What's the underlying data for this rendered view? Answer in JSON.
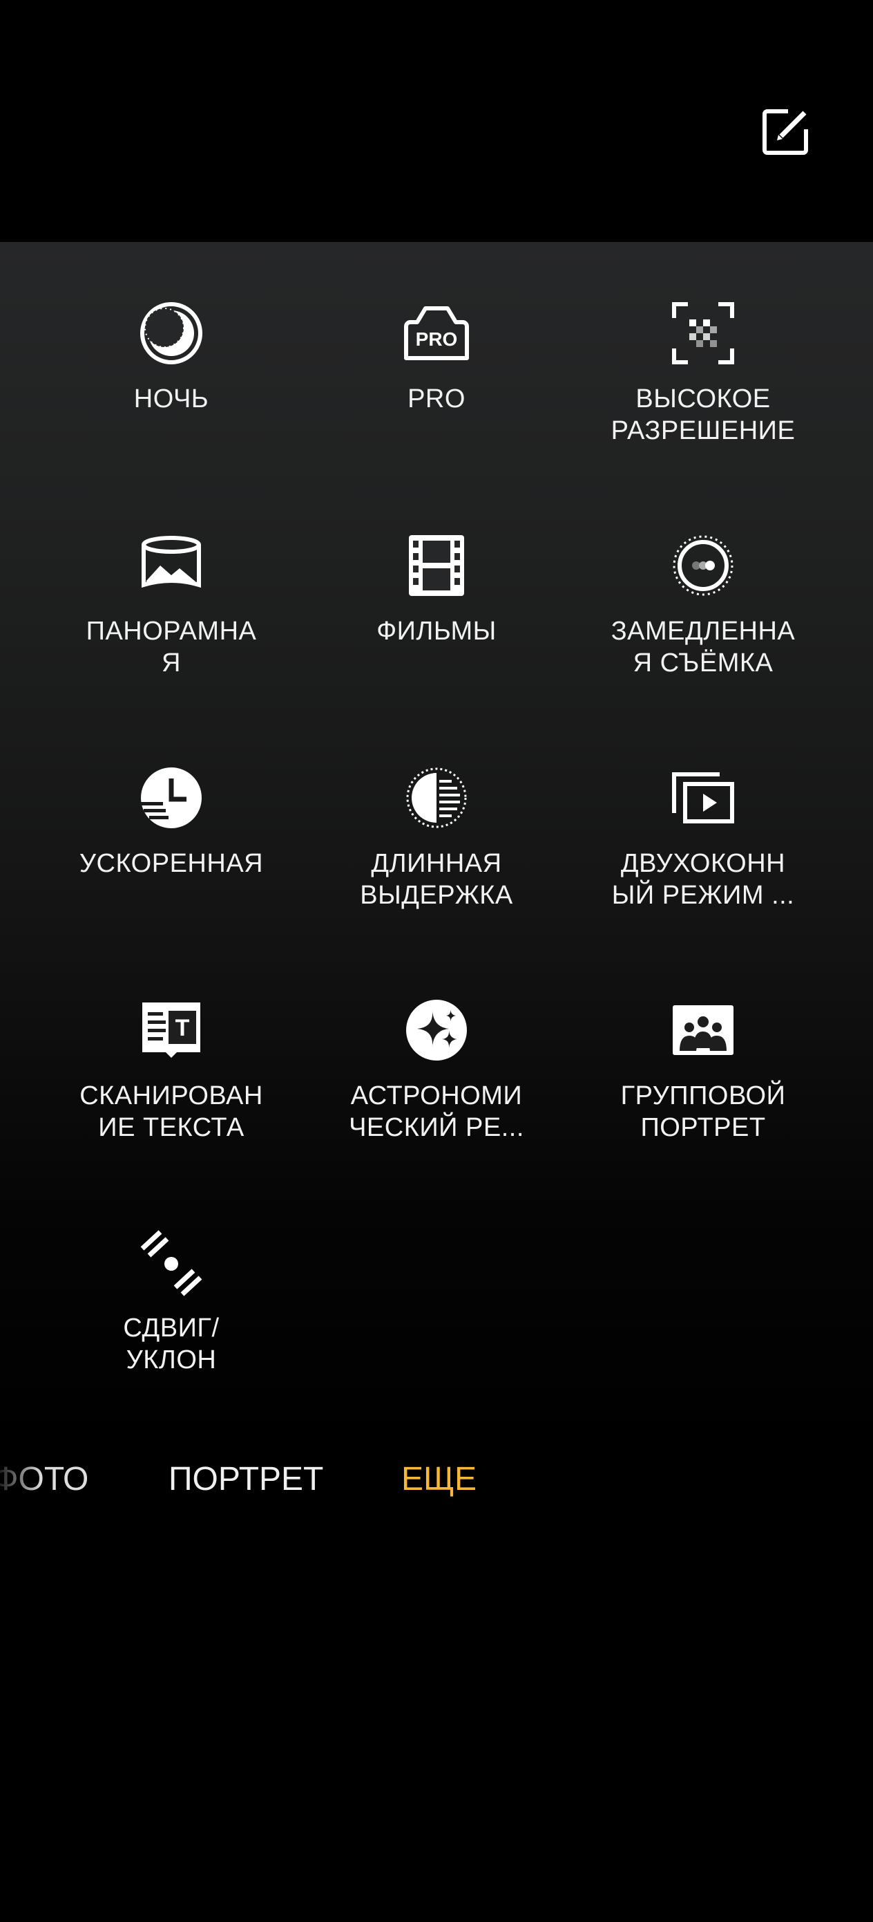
{
  "header": {
    "edit_icon": "edit-icon"
  },
  "modes": [
    {
      "label": "НОЧЬ",
      "icon": "night-icon"
    },
    {
      "label": "PRO",
      "icon": "pro-camera-icon",
      "icon_text": "PRO"
    },
    {
      "label": "ВЫСОКОЕ\nРАЗРЕШЕНИЕ",
      "icon": "high-resolution-icon"
    },
    {
      "label": "ПАНОРАМНА\nЯ",
      "icon": "panorama-icon"
    },
    {
      "label": "ФИЛЬМЫ",
      "icon": "film-icon"
    },
    {
      "label": "ЗАМЕДЛЕННА\nЯ СЪЁМКА",
      "icon": "slow-motion-icon"
    },
    {
      "label": "УСКОРЕННАЯ",
      "icon": "time-lapse-icon"
    },
    {
      "label": "ДЛИННАЯ\nВЫДЕРЖКА",
      "icon": "long-exposure-icon"
    },
    {
      "label": "ДВУХОКОНН\nЫЙ РЕЖИМ ...",
      "icon": "dual-view-icon"
    },
    {
      "label": "СКАНИРОВАН\nИЕ ТЕКСТА",
      "icon": "text-scan-icon"
    },
    {
      "label": "АСТРОНОМИ\nЧЕСКИЙ РЕ...",
      "icon": "astro-icon"
    },
    {
      "label": "ГРУППОВОЙ\nПОРТРЕТ",
      "icon": "group-portrait-icon"
    },
    {
      "label": "СДВИГ/\nУКЛОН",
      "icon": "tilt-shift-icon"
    }
  ],
  "tabs": {
    "photo": "ФОТО",
    "portrait": "ПОРТРЕТ",
    "more": "ЕЩЕ"
  },
  "colors": {
    "accent": "#f6b73c",
    "text": "#f2f2f2",
    "background": "#000000"
  }
}
